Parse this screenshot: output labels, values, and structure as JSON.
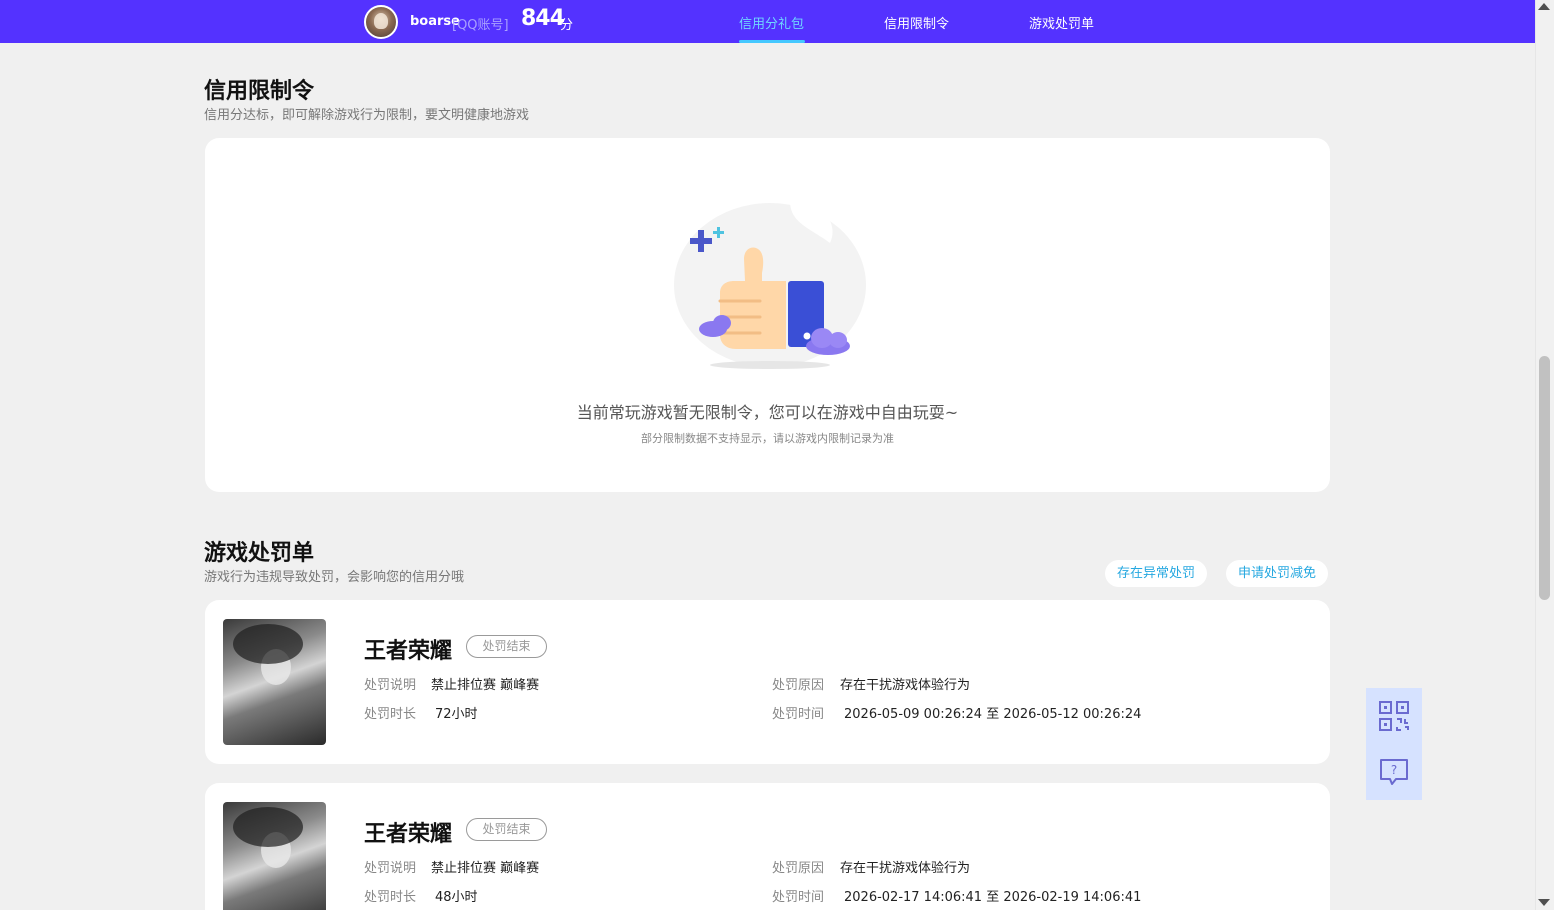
{
  "header": {
    "username": "boarse",
    "account_type": "[QQ账号]",
    "score": "844",
    "score_unit": "分",
    "tabs": [
      {
        "label": "信用分礼包",
        "active": true
      },
      {
        "label": "信用限制令",
        "active": false
      },
      {
        "label": "游戏处罚单",
        "active": false
      }
    ]
  },
  "restrictions": {
    "title": "信用限制令",
    "subtitle": "信用分达标，即可解除游戏行为限制，要文明健康地游戏",
    "empty_message": "当前常玩游戏暂无限制令，您可以在游戏中自由玩耍~",
    "empty_note": "部分限制数据不支持显示，请以游戏内限制记录为准"
  },
  "penalties": {
    "title": "游戏处罚单",
    "subtitle": "游戏行为违规导致处罚，会影响您的信用分哦",
    "buttons": {
      "abnormal": "存在异常处罚",
      "appeal": "申请处罚减免"
    },
    "labels": {
      "desc": "处罚说明",
      "duration": "处罚时长",
      "reason": "处罚原因",
      "time": "处罚时间"
    },
    "items": [
      {
        "game": "王者荣耀",
        "status": "处罚结束",
        "desc": "禁止排位赛 巅峰赛",
        "duration": "72小时",
        "reason": "存在干扰游戏体验行为",
        "time": "2026-05-09 00:26:24 至 2026-05-12 00:26:24"
      },
      {
        "game": "王者荣耀",
        "status": "处罚结束",
        "desc": "禁止排位赛 巅峰赛",
        "duration": "48小时",
        "reason": "存在干扰游戏体验行为",
        "time": "2026-02-17 14:06:41 至 2026-02-19 14:06:41"
      }
    ]
  },
  "floating": {
    "icons": [
      "qr-code-icon",
      "help-chat-icon"
    ]
  },
  "colors": {
    "nav_bg": "#5432ff",
    "accent": "#45c8ff",
    "link": "#26a8e0",
    "page_bg": "#f0f0f0"
  }
}
